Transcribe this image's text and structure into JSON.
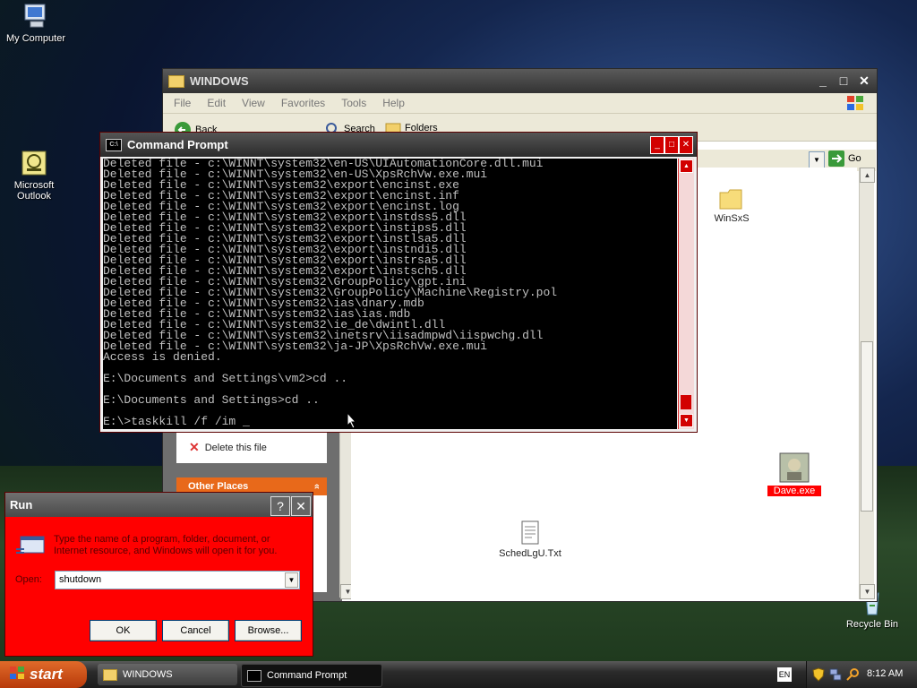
{
  "desktop": {
    "icons": [
      {
        "label": "My Computer"
      },
      {
        "label": "Microsoft Outlook"
      },
      {
        "label": "Recycle Bin"
      }
    ]
  },
  "explorer": {
    "title": "WINDOWS",
    "menu": [
      "File",
      "Edit",
      "View",
      "Favorites",
      "Tools",
      "Help"
    ],
    "toolbar": {
      "back": "Back",
      "search": "Search",
      "folders": "Folders"
    },
    "go_label": "Go",
    "sidebar": {
      "task": "Delete this file",
      "other_places": "Other Places",
      "collapse_glyph": "»"
    },
    "files": [
      {
        "name": "WinSxS",
        "type": "folder"
      },
      {
        "name": "SchedLgU.Txt",
        "type": "text"
      },
      {
        "name": "Dave.exe",
        "type": "exe",
        "selected": true
      }
    ]
  },
  "cmd": {
    "title": "Command Prompt",
    "icon_text": "C:\\",
    "lines": [
      "Deleted file - c:\\WINNT\\system32\\en-US\\UIAutomationCore.dll.mui",
      "Deleted file - c:\\WINNT\\system32\\en-US\\XpsRchVw.exe.mui",
      "Deleted file - c:\\WINNT\\system32\\export\\encinst.exe",
      "Deleted file - c:\\WINNT\\system32\\export\\encinst.inf",
      "Deleted file - c:\\WINNT\\system32\\export\\encinst.log",
      "Deleted file - c:\\WINNT\\system32\\export\\instdss5.dll",
      "Deleted file - c:\\WINNT\\system32\\export\\instips5.dll",
      "Deleted file - c:\\WINNT\\system32\\export\\instlsa5.dll",
      "Deleted file - c:\\WINNT\\system32\\export\\instndi5.dll",
      "Deleted file - c:\\WINNT\\system32\\export\\instrsa5.dll",
      "Deleted file - c:\\WINNT\\system32\\export\\instsch5.dll",
      "Deleted file - c:\\WINNT\\system32\\GroupPolicy\\gpt.ini",
      "Deleted file - c:\\WINNT\\system32\\GroupPolicy\\Machine\\Registry.pol",
      "Deleted file - c:\\WINNT\\system32\\ias\\dnary.mdb",
      "Deleted file - c:\\WINNT\\system32\\ias\\ias.mdb",
      "Deleted file - c:\\WINNT\\system32\\ie_de\\dwintl.dll",
      "Deleted file - c:\\WINNT\\system32\\inetsrv\\iisadmpwd\\iispwchg.dll",
      "Deleted file - c:\\WINNT\\system32\\ja-JP\\XpsRchVw.exe.mui",
      "Access is denied.",
      "",
      "E:\\Documents and Settings\\vm2>cd ..",
      "",
      "E:\\Documents and Settings>cd ..",
      "",
      "E:\\>taskkill /f /im _"
    ]
  },
  "run": {
    "title": "Run",
    "help_glyph": "?",
    "description": "Type the name of a program, folder, document, or Internet resource, and Windows will open it for you.",
    "open_label": "Open:",
    "open_value": "shutdown",
    "ok": "OK",
    "cancel": "Cancel",
    "browse": "Browse..."
  },
  "taskbar": {
    "start": "start",
    "tasks": [
      {
        "label": "WINDOWS"
      },
      {
        "label": "Command Prompt",
        "active": true
      }
    ],
    "lang": "EN",
    "clock": "8:12 AM"
  },
  "colors": {
    "run_bg": "#ff0000",
    "cmd_accent": "#d20000",
    "sidebar_orange": "#e8691a"
  }
}
